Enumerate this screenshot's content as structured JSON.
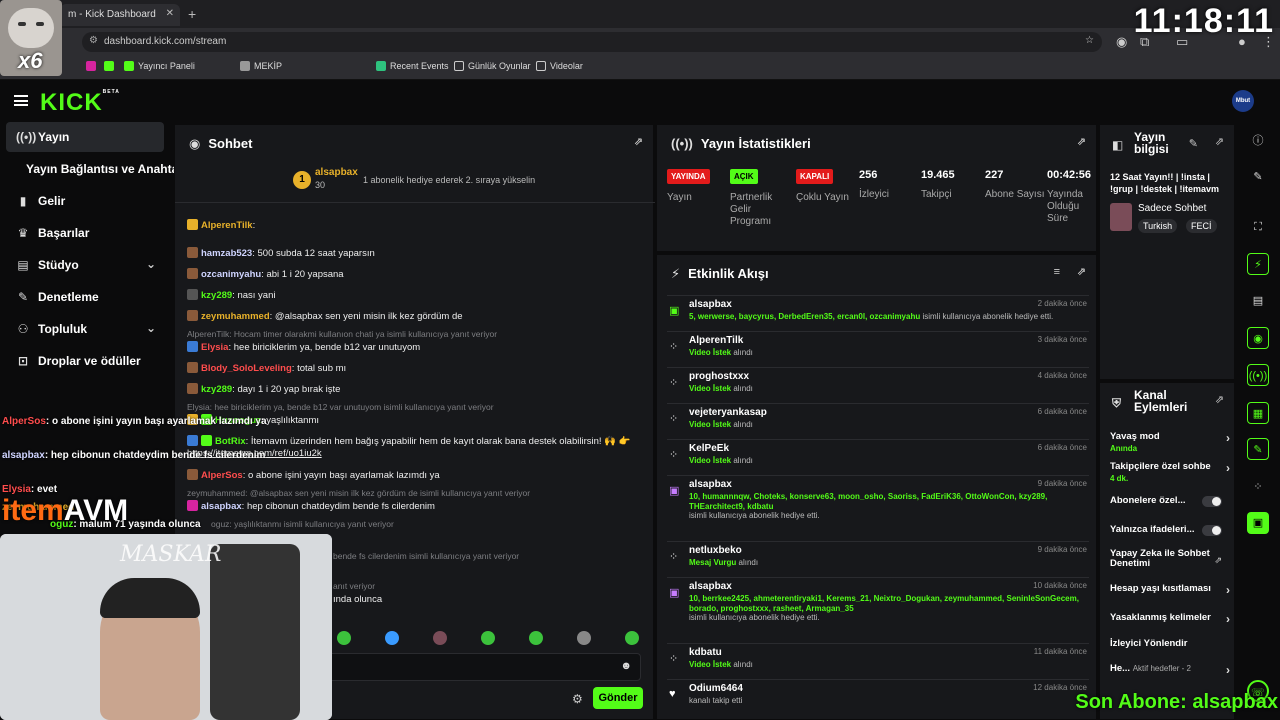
{
  "browser": {
    "tab_title": "m - Kick Dashboard",
    "url": "dashboard.kick.com/stream",
    "bookmarks": [
      "Yayıncı Paneli",
      "MEKİP",
      "Recent Events",
      "Günlük Oyunlar",
      "Videolar"
    ]
  },
  "overlay": {
    "clock": "11:18:11",
    "cat_badge": "x6",
    "son_abone": "Son Abone: alsapbax",
    "brand_left": "item",
    "brand_right": "AVM",
    "cam_text": "MASKAR",
    "left_chat": [
      {
        "user": "AlperSos",
        "text": ": o abone işini yayın başı ayarlamak lazımdı ya"
      },
      {
        "user": "alsapbax",
        "text": ": hep cibonun chatdeydim bende fs cilerdenim"
      },
      {
        "user": "Elysia",
        "text": ": evet"
      },
      {
        "user": "zeymuhammed",
        "text": ""
      },
      {
        "user": "oguz",
        "text": ": malum 71 yaşında olunca"
      }
    ]
  },
  "header": {
    "logo": "KICK",
    "beta": "BETA",
    "avatar": "Mbut"
  },
  "sidebar": {
    "items": [
      {
        "label": "Yayın",
        "icon": "stream-icon"
      },
      {
        "label": "Yayın Bağlantısı ve Anahtarı",
        "icon": ""
      },
      {
        "label": "Gelir",
        "icon": "chart-icon"
      },
      {
        "label": "Başarılar",
        "icon": "trophy-icon"
      },
      {
        "label": "Stüdyo",
        "icon": "studio-icon"
      },
      {
        "label": "Denetleme",
        "icon": "wrench-icon"
      },
      {
        "label": "Topluluk",
        "icon": "people-icon"
      },
      {
        "label": "Droplar ve ödüller",
        "icon": "gift-icon"
      }
    ]
  },
  "chat": {
    "title": "Sohbet",
    "pinned_user": "alsapbax",
    "pinned_count": "30",
    "pinned_text": "1 abonelik hediye ederek 2. sıraya yükselin",
    "send": "Gönder",
    "messages": [
      {
        "user": "AlperenTilk",
        "color": "#e8b12a",
        "text": ":"
      },
      {
        "user": "hamzab523",
        "color": "#cfd4ff",
        "text": ": 500 subda 12 saat yaparsın"
      },
      {
        "user": "ozcanimyahu",
        "color": "#cfd4ff",
        "text": ": abi 1 i 20 yapsana"
      },
      {
        "user": "kzy289",
        "color": "#53fc18",
        "text": ": nası yani"
      },
      {
        "user": "zeymuhammed",
        "color": "#e8b12a",
        "text": ": @alsapbax sen yeni misin ilk kez gördüm de"
      },
      {
        "user": "Elysia",
        "color": "#ff4d4d",
        "text": ": hee biriciklerim ya, bende b12 var unutuyom"
      },
      {
        "user": "Blody_SoloLeveling",
        "color": "#ff4d4d",
        "text": ": total sub mı"
      },
      {
        "user": "kzy289",
        "color": "#53fc18",
        "text": ": dayı 1 i 20 yap bırak işte"
      },
      {
        "user": "Husooguz",
        "color": "#53fc18",
        "text": ": yaşlılıktanmı"
      },
      {
        "user": "BotRix",
        "color": "#53fc18",
        "text": ": İtemavm üzerinden hem bağış yapabilir hem de kayıt olarak bana destek olabilirsin! 🙌 👉"
      },
      {
        "user": "",
        "color": "#fff",
        "text": "https://itemavm.com/ref/uo1iu2k"
      },
      {
        "user": "AlperSos",
        "color": "#ff4d4d",
        "text": ": o abone işini yayın başı ayarlamak lazımdı ya"
      },
      {
        "user": "alsapbax",
        "color": "#cfd4ff",
        "text": ": hep cibonun chatdeydim bende fs cilerdenim"
      },
      {
        "user": "",
        "color": "#fff",
        "text": "ında olunca"
      }
    ],
    "replies": [
      "AlperenTilk: Hocam timer olarakmi kullanıon chati ya isimli kullanıcıya yanıt veriyor",
      "Elysia: hee biriciklerim ya, bende b12 var unutuyom isimli kullanıcıya yanıt veriyor",
      "zeymuhammed: @alsapbax sen yeni misin ilk kez gördüm de isimli kullanıcıya yanıt veriyor",
      "oguz: yaşlılıktanmı isimli kullanıcıya yanıt veriyor",
      "bende fs cilerdenim isimli kullanıcıya yanıt veriyor",
      "anıt veriyor"
    ]
  },
  "stats": {
    "title": "Yayın İstatistikleri",
    "items": [
      {
        "tag": "YAYINDA",
        "tag_color": "red",
        "label": "Yayın"
      },
      {
        "tag": "AÇIK",
        "tag_color": "green",
        "label": "Partnerlik Gelir Programı"
      },
      {
        "tag": "KAPALI",
        "tag_color": "red",
        "label": "Çoklu Yayın"
      },
      {
        "value": "256",
        "label": "İzleyici"
      },
      {
        "value": "19.465",
        "label": "Takipçi"
      },
      {
        "value": "227",
        "label": "Abone Sayısı"
      },
      {
        "value": "00:42:56",
        "label": "Yayında Olduğu Süre"
      }
    ]
  },
  "activity": {
    "title": "Etkinlik Akışı",
    "items": [
      {
        "name": "alsapbax",
        "icon": "gift-icon",
        "green": "5, werwerse, baycyrus, DerbedEren35, ercan0l, ozcanimyahu",
        "sub": "isimli kullanıcıya abonelik hediye etti.",
        "time": "2 dakika önce"
      },
      {
        "name": "AlperenTilk",
        "icon": "dots-icon",
        "green": "Video İstek",
        "sub": "alındı",
        "time": "3 dakika önce"
      },
      {
        "name": "proghostxxx",
        "icon": "dots-icon",
        "green": "Video İstek",
        "sub": "alındı",
        "time": "4 dakika önce"
      },
      {
        "name": "vejeteryankasap",
        "icon": "dots-icon",
        "green": "Video İstek",
        "sub": "alındı",
        "time": "6 dakika önce"
      },
      {
        "name": "KelPeEk",
        "icon": "dots-icon",
        "green": "Video İstek",
        "sub": "alındı",
        "time": "6 dakika önce"
      },
      {
        "name": "alsapbax",
        "icon": "gift-icon",
        "green": "10, humannnqw, Choteks, konserve63, moon_osho, Saoriss, FadEriK36, OttoWonCon, kzy289, THEarchitect9, kdbatu",
        "sub": "isimli kullanıcıya abonelik hediye etti.",
        "time": "9 dakika önce"
      },
      {
        "name": "netluxbeko",
        "icon": "dots-icon",
        "green": "Mesaj Vurgu",
        "sub": "alındı",
        "time": "9 dakika önce"
      },
      {
        "name": "alsapbax",
        "icon": "gift-icon",
        "green": "10, berrkee2425, ahmeterentiryaki1, Kerems_21, Neixtro_Dogukan, zeymuhammed, SeninleSonGecem, borado, proghostxxx, rasheet, Armagan_35",
        "sub": "isimli kullanıcıya abonelik hediye etti.",
        "time": "10 dakika önce"
      },
      {
        "name": "kdbatu",
        "icon": "dots-icon",
        "green": "Video İstek",
        "sub": "alındı",
        "time": "11 dakika önce"
      },
      {
        "name": "Odium6464",
        "icon": "heart-icon",
        "green": "",
        "sub": "kanalı takip etti",
        "time": "12 dakika önce"
      }
    ]
  },
  "stream_info": {
    "title": "Yayın bilgisi",
    "stream_title": "12 Saat Yayın!! | !insta | !grup | !destek | !itemavm",
    "category": "Sadece Sohbet",
    "chips": [
      "Turkish",
      "FECİ"
    ]
  },
  "channel_actions": {
    "title": "Kanal Eylemleri",
    "items": [
      {
        "label": "Yavaş mod",
        "sub": "Anında",
        "type": "arrow"
      },
      {
        "label": "Takipçilere özel sohbe",
        "sub": "4 dk.",
        "type": "arrow"
      },
      {
        "label": "Abonelere özel...",
        "sub": "",
        "type": "toggle"
      },
      {
        "label": "Yalnızca ifadeleri...",
        "sub": "",
        "type": "toggle"
      },
      {
        "label": "Yapay Zeka ile Sohbet Denetimi",
        "sub": "",
        "type": "external"
      },
      {
        "label": "Hesap yaşı kısıtlaması",
        "sub": "",
        "type": "arrow"
      },
      {
        "label": "Yasaklanmış kelimeler",
        "sub": "",
        "type": "arrow"
      },
      {
        "label": "İzleyici Yönlendir",
        "sub": "",
        "type": "none"
      },
      {
        "label": "He...",
        "sub": "Aktif hedefler - 2",
        "type": "arrow"
      }
    ]
  }
}
